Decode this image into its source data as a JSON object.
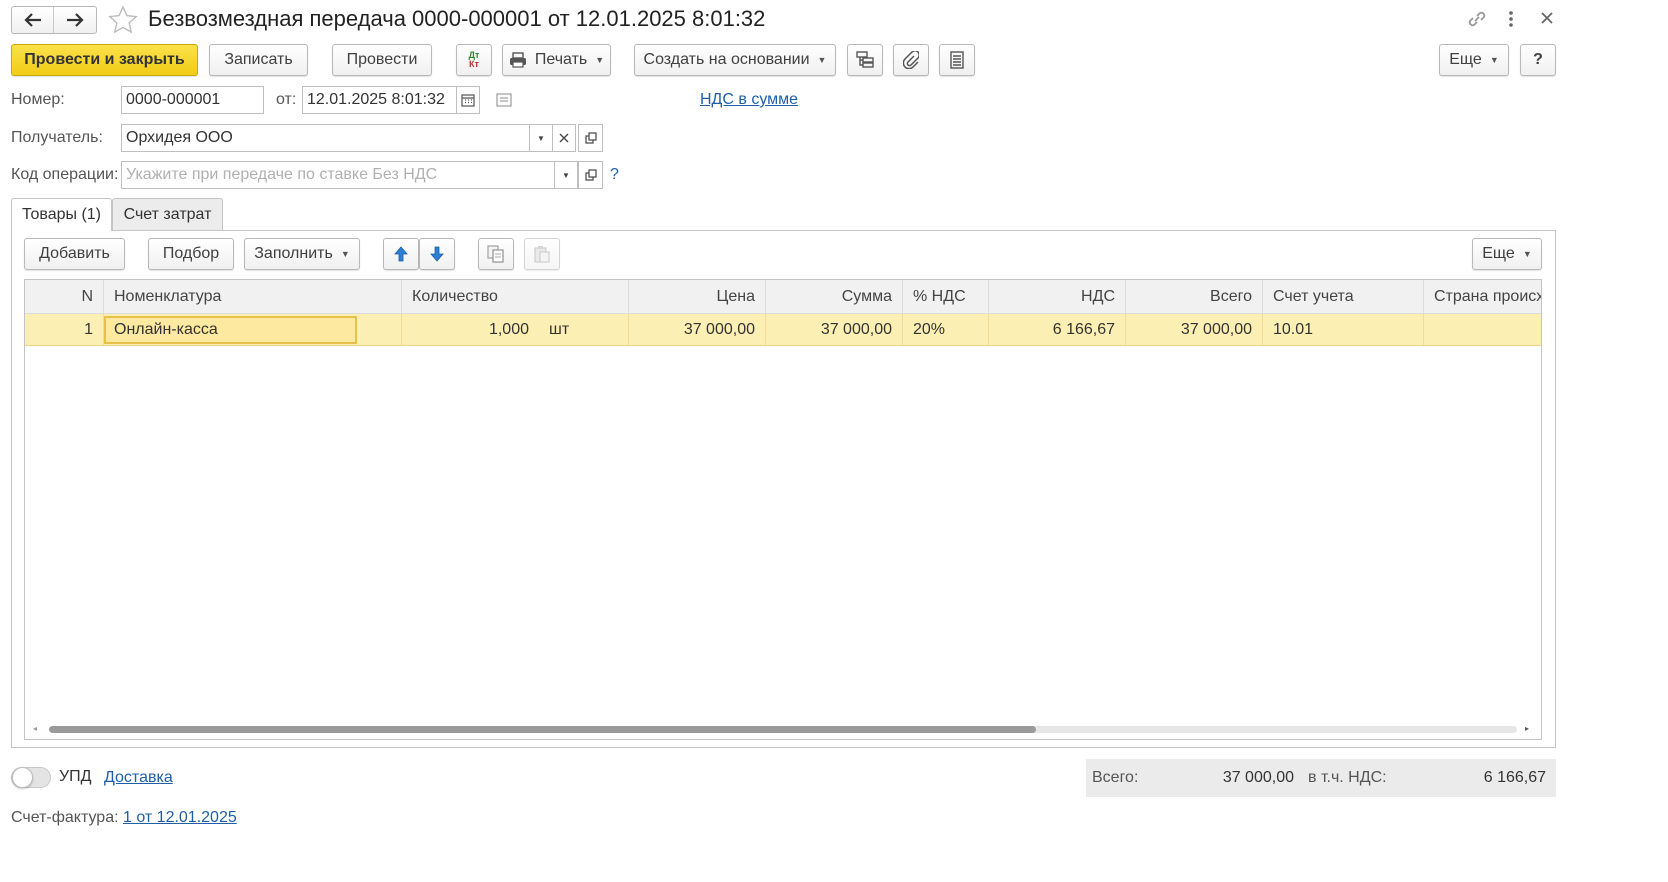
{
  "window": {
    "title": "Безвозмездная передача 0000-000001 от 12.01.2025 8:01:32"
  },
  "toolbar": {
    "post_close": "Провести и закрыть",
    "save": "Записать",
    "post": "Провести",
    "print": "Печать",
    "create_based": "Создать на основании",
    "more": "Еще",
    "help": "?"
  },
  "form": {
    "number_label": "Номер:",
    "number_value": "0000-000001",
    "date_label": "от:",
    "date_value": "12.01.2025  8:01:32",
    "vat_link": "НДС в сумме",
    "recipient_label": "Получатель:",
    "recipient_value": "Орхидея ООО",
    "opcode_label": "Код операции:",
    "opcode_placeholder": "Укажите при передаче по ставке Без НДС",
    "opcode_help": "?"
  },
  "tabs": [
    {
      "label": "Товары (1)",
      "active": true
    },
    {
      "label": "Счет затрат",
      "active": false
    }
  ],
  "table_toolbar": {
    "add": "Добавить",
    "pick": "Подбор",
    "fill": "Заполнить",
    "more": "Еще"
  },
  "table": {
    "columns": [
      "N",
      "Номенклатура",
      "Количество",
      "Цена",
      "Сумма",
      "% НДС",
      "НДС",
      "Всего",
      "Счет учета",
      "Страна происхождения"
    ],
    "rows": [
      {
        "n": "1",
        "item": "Онлайн-касса",
        "qty": "1,000",
        "unit": "шт",
        "price": "37 000,00",
        "sum": "37 000,00",
        "vat_rate": "20%",
        "vat": "6 166,67",
        "total": "37 000,00",
        "account": "10.01",
        "country": ""
      }
    ]
  },
  "footer": {
    "upd_label": "УПД",
    "upd_enabled": false,
    "delivery_link": "Доставка",
    "total_label": "Всего:",
    "total_value": "37 000,00",
    "vat_label": "в т.ч. НДС:",
    "vat_value": "6 166,67",
    "invoice_label": "Счет-фактура:",
    "invoice_link": "1 от 12.01.2025"
  },
  "colors": {
    "primary_button": "#f2cd16",
    "selected_row": "#fcefb4",
    "link": "#1f5fa8",
    "arrow_blue": "#2b7fd4"
  }
}
